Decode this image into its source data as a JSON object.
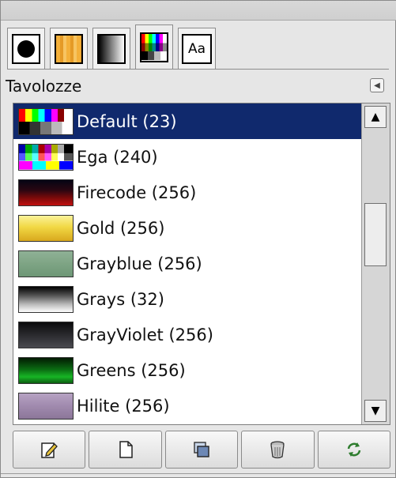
{
  "panel": {
    "title": "Tavolozze",
    "tabs": [
      {
        "icon": "brush-icon"
      },
      {
        "icon": "pattern-icon"
      },
      {
        "icon": "gradient-icon"
      },
      {
        "icon": "palette-icon"
      },
      {
        "icon": "font-icon",
        "label": "Aa"
      }
    ],
    "active_tab_index": 3
  },
  "palettes": [
    {
      "name": "Default (23)",
      "selected": true
    },
    {
      "name": "Ega (240)",
      "selected": false
    },
    {
      "name": "Firecode (256)",
      "selected": false
    },
    {
      "name": "Gold (256)",
      "selected": false
    },
    {
      "name": "Grayblue (256)",
      "selected": false
    },
    {
      "name": "Grays (32)",
      "selected": false
    },
    {
      "name": "GrayViolet (256)",
      "selected": false
    },
    {
      "name": "Greens (256)",
      "selected": false
    },
    {
      "name": "Hilite (256)",
      "selected": false
    }
  ],
  "actions": [
    {
      "icon": "edit-icon"
    },
    {
      "icon": "new-document-icon"
    },
    {
      "icon": "duplicate-icon"
    },
    {
      "icon": "trash-icon"
    },
    {
      "icon": "refresh-icon"
    }
  ],
  "colors": {
    "selection": "#10296d",
    "selection_text": "#ffffff",
    "panel_bg": "#e6e6e6"
  }
}
